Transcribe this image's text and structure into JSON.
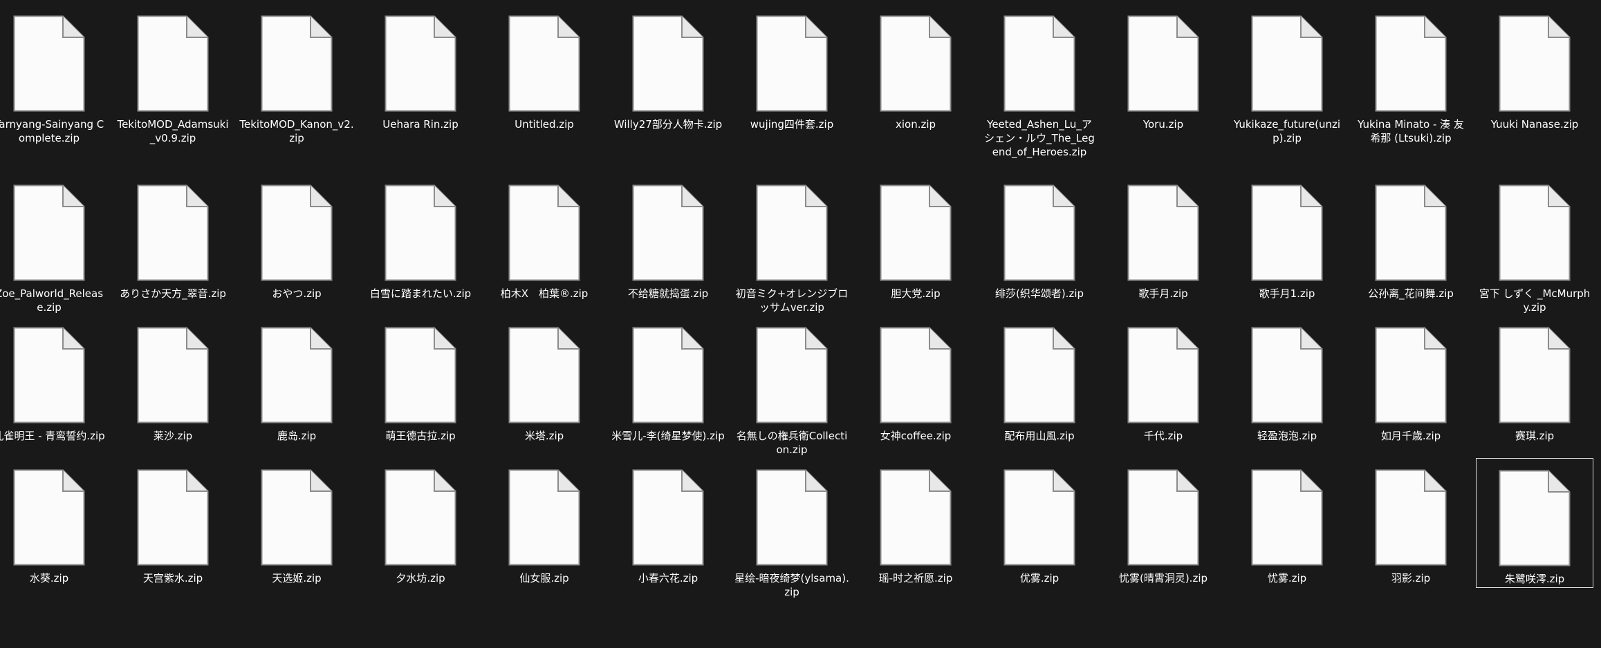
{
  "selected_index": 51,
  "rows": [
    [
      "Tarnyang-Sainyang Complete.zip",
      "TekitoMOD_Adamsuki_v0.9.zip",
      "TekitoMOD_Kanon_v2.zip",
      "Uehara Rin.zip",
      "Untitled.zip",
      "Willy27部分人物卡.zip",
      "wujing四件套.zip",
      "xion.zip",
      "Yeeted_Ashen_Lu_アシェン・ルウ_The_Legend_of_Heroes.zip",
      "Yoru.zip",
      "Yukikaze_future(unzip).zip",
      "Yukina Minato - 湊 友希那 (Ltsuki).zip",
      "Yuuki Nanase.zip"
    ],
    [
      "Zoe_Palworld_Release.zip",
      "ありさか天方_翠音.zip",
      "おやつ.zip",
      "白雪に踏まれたい.zip",
      "柏木X　柏葉®.zip",
      "不给糖就捣蛋.zip",
      "初音ミク+オレンジブロッサムver.zip",
      "胆大党.zip",
      "绯莎(织华颂者).zip",
      "歌手月.zip",
      "歌手月1.zip",
      "公孙离_花间舞.zip",
      "宮下 しずく _McMurphy.zip"
    ],
    [
      "孔雀明王 - 青鸾誓约.zip",
      "莱沙.zip",
      "鹿岛.zip",
      "萌王德古拉.zip",
      "米塔.zip",
      "米雪儿-李(绮星梦使).zip",
      "名無しの権兵衛Collection.zip",
      "女神coffee.zip",
      "配布用山風.zip",
      "千代.zip",
      "轻盈泡泡.zip",
      "如月千歳.zip",
      "赛琪.zip"
    ],
    [
      "水葵.zip",
      "天宫紫水.zip",
      "天选姬.zip",
      "夕水坊.zip",
      "仙女服.zip",
      "小春六花.zip",
      "星绘-暗夜绮梦(ylsama).zip",
      "瑶-时之祈愿.zip",
      "优雾.zip",
      "忧雾(晴霄洞灵).zip",
      "忧雾.zip",
      "羽影.zip",
      "朱鹭咲澪.zip"
    ]
  ],
  "colors": {
    "background": "#191919",
    "icon_fill": "#fbfbfb",
    "icon_stroke": "#8c8c8c",
    "text": "#ffffff",
    "selection_border": "#dcdcdc"
  },
  "icon_name": "file-document-icon"
}
